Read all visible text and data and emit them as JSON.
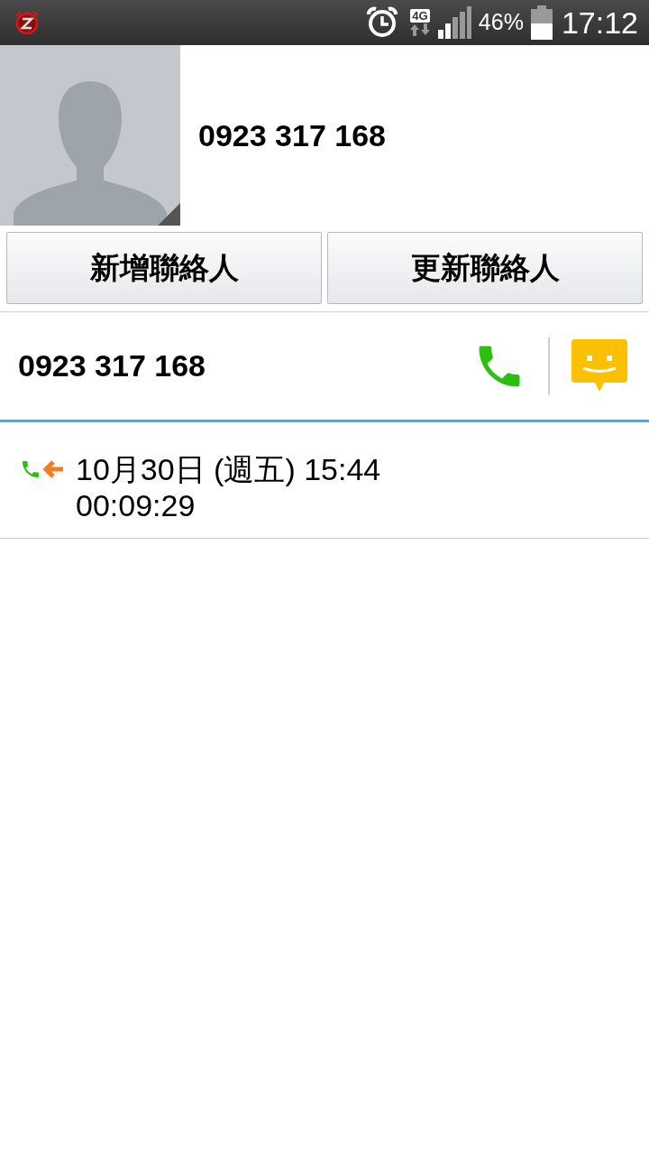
{
  "status_bar": {
    "network": "4G",
    "battery": "46%",
    "time": "17:12"
  },
  "contact": {
    "title": "0923 317 168"
  },
  "buttons": [
    "新增聯絡人",
    "更新聯絡人"
  ],
  "number_row": {
    "number": "0923 317 168"
  },
  "call_log": [
    {
      "kind": "incoming",
      "date": "10月30日 (週五) 15:44",
      "duration": "00:09:29"
    }
  ]
}
